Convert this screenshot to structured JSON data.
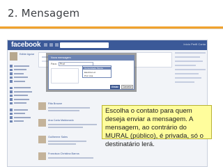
{
  "slide": {
    "title": "2. Mensagem",
    "accent_color": "#f0a22e"
  },
  "screenshot": {
    "logo": "facebook",
    "top_links": "Início  Perfil  Conta",
    "profile_name": "Edilde Aguiar",
    "dialog": {
      "title": "Nova mensagem",
      "to_label": "Para:",
      "to_value": "Prof",
      "dropdown_options": [
        "Comunidade Pérola",
        "Elenilza Luz",
        "Prof. Ana"
      ],
      "send_label": "Enviar",
      "cancel_label": "Cancelar"
    },
    "feed_names": [
      "Rita Braune",
      "Ana Carla Maldonado",
      "Guilherme Sales",
      "Francisca Christina Barros"
    ]
  },
  "callout": {
    "text": "Escolha o contato para quem deseja enviar a mensagem. A mensagem, ao contrário do MURAL (público), é privada, só o destinatário lerá."
  }
}
